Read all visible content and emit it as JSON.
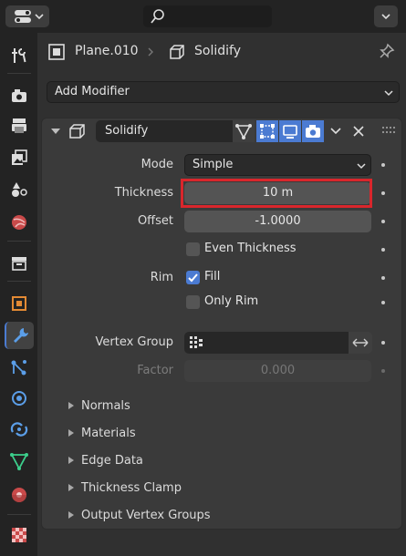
{
  "topbar": {
    "search_placeholder": ""
  },
  "header": {
    "object_name": "Plane.010",
    "modifier_name": "Solidify"
  },
  "add_modifier": {
    "label": "Add Modifier"
  },
  "modifier": {
    "name": "Solidify",
    "fields": {
      "mode_label": "Mode",
      "mode_value": "Simple",
      "thickness_label": "Thickness",
      "thickness_value": "10 m",
      "offset_label": "Offset",
      "offset_value": "-1.0000",
      "even_thickness_label": "Even Thickness",
      "rim_label": "Rim",
      "fill_label": "Fill",
      "only_rim_label": "Only Rim",
      "vertex_group_label": "Vertex Group",
      "factor_label": "Factor",
      "factor_value": "0.000"
    },
    "checkboxes": {
      "even_thickness": false,
      "fill": true,
      "only_rim": false
    }
  },
  "subpanels": [
    "Normals",
    "Materials",
    "Edge Data",
    "Thickness Clamp",
    "Output Vertex Groups"
  ],
  "colors": {
    "accent": "#4b7bd2",
    "highlight": "#d9262c",
    "modifier_tab_icon": "#5b9ee8"
  }
}
